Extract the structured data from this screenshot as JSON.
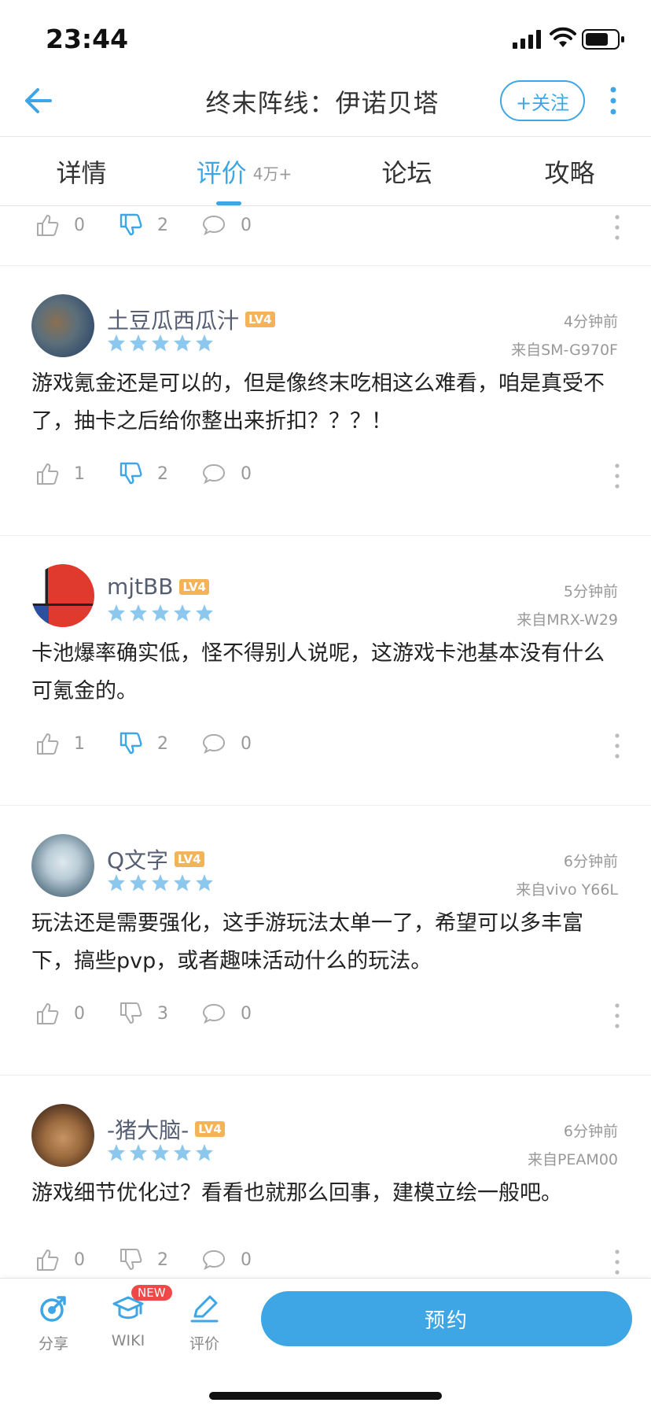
{
  "status_bar": {
    "time": "23:44"
  },
  "nav": {
    "title": "终末阵线：伊诺贝塔",
    "follow_label": "+关注"
  },
  "tabs": [
    {
      "label": "详情",
      "count": ""
    },
    {
      "label": "评价",
      "count": "4万+"
    },
    {
      "label": "论坛",
      "count": ""
    },
    {
      "label": "攻略",
      "count": ""
    }
  ],
  "partial_review": {
    "likes": "0",
    "dislikes": "2",
    "comments": "0"
  },
  "reviews": [
    {
      "username": "土豆瓜西瓜汁",
      "level": "LV4",
      "rating": 5,
      "time": "4分钟前",
      "device": "来自SM-G970F",
      "text": "游戏氪金还是可以的，但是像终末吃相这么难看，咱是真受不了，抽卡之后给你整出来折扣？？？！",
      "likes": "1",
      "dislikes": "2",
      "comments": "0",
      "disliked": true
    },
    {
      "username": "mjtBB",
      "level": "LV4",
      "rating": 5,
      "time": "5分钟前",
      "device": "来自MRX-W29",
      "text": "卡池爆率确实低，怪不得别人说呢，这游戏卡池基本没有什么可氪金的。",
      "likes": "1",
      "dislikes": "2",
      "comments": "0",
      "disliked": true
    },
    {
      "username": "Q文字",
      "level": "LV4",
      "rating": 5,
      "time": "6分钟前",
      "device": "来自vivo  Y66L",
      "text": "玩法还是需要强化，这手游玩法太单一了，希望可以多丰富下，搞些pvp，或者趣味活动什么的玩法。",
      "likes": "0",
      "dislikes": "3",
      "comments": "0",
      "disliked": false
    },
    {
      "username": "-猪大脑-",
      "level": "LV4",
      "rating": 5,
      "time": "6分钟前",
      "device": "来自PEAM00",
      "text": "游戏细节优化过？看看也就那么回事，建模立绘一般吧。",
      "likes": "0",
      "dislikes": "2",
      "comments": "0",
      "disliked": false
    }
  ],
  "bottom_bar": {
    "share_label": "分享",
    "wiki_label": "WIKI",
    "new_badge": "NEW",
    "review_label": "评价",
    "reserve_label": "预约"
  },
  "colors": {
    "accent": "#3ea6e4",
    "badge": "#f5b357",
    "star": "#8cc8ee",
    "new_badge": "#f04848"
  }
}
